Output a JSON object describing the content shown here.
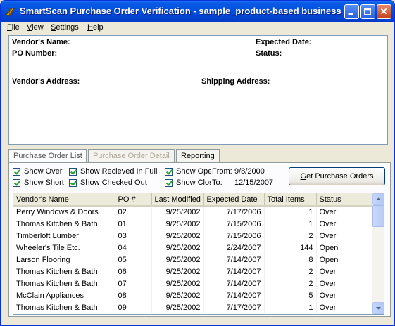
{
  "window": {
    "title": "SmartScan Purchase Order Verification - sample_product-based business"
  },
  "menu": [
    {
      "accel": "F",
      "rest": "ile"
    },
    {
      "accel": "V",
      "rest": "iew"
    },
    {
      "accel": "S",
      "rest": "ettings"
    },
    {
      "accel": "H",
      "rest": "elp"
    }
  ],
  "info": {
    "vendor_name_label": "Vendor's Name:",
    "po_number_label": "PO  Number:",
    "vendor_address_label": "Vendor's Address:",
    "expected_date_label": "Expected Date:",
    "status_label": "Status:",
    "shipping_address_label": "Shipping Address:"
  },
  "tabs": {
    "list": "Purchase Order List",
    "detail": "Purchase Order Detail",
    "reporting": "Reporting"
  },
  "filters": {
    "show_over": "Show Over",
    "show_short": "Show Short",
    "show_received_full": "Show Recieved In Full",
    "show_checked_out": "Show Checked Out",
    "show_open": "Show Open",
    "show_closed": "Show Closed",
    "from_label": "From:",
    "from_value": "9/8/2000",
    "to_label": "To:",
    "to_value": "12/15/2007"
  },
  "get_po_button": {
    "accel": "G",
    "rest": "et Purchase Orders"
  },
  "table": {
    "columns": [
      "Vendor's Name",
      "PO #",
      "Last Modified",
      "Expected Date",
      "Total Items",
      "Status"
    ],
    "rows": [
      [
        "Perry Windows & Doors",
        "02",
        "9/25/2002",
        "7/17/2006",
        "1",
        "Over"
      ],
      [
        "Thomas Kitchen & Bath",
        "01",
        "9/25/2002",
        "7/15/2006",
        "1",
        "Over"
      ],
      [
        "Timberloft Lumber",
        "03",
        "9/25/2002",
        "7/15/2006",
        "2",
        "Over"
      ],
      [
        "Wheeler's Tile Etc.",
        "04",
        "9/25/2002",
        "2/24/2007",
        "144",
        "Open"
      ],
      [
        "Larson Flooring",
        "05",
        "9/25/2002",
        "7/14/2007",
        "8",
        "Open"
      ],
      [
        "Thomas Kitchen & Bath",
        "06",
        "9/25/2002",
        "7/14/2007",
        "2",
        "Over"
      ],
      [
        "Thomas Kitchen & Bath",
        "07",
        "9/25/2002",
        "7/14/2007",
        "2",
        "Over"
      ],
      [
        "McClain Appliances",
        "08",
        "9/25/2002",
        "7/14/2007",
        "5",
        "Over"
      ],
      [
        "Thomas Kitchen & Bath",
        "09",
        "9/25/2002",
        "7/17/2007",
        "1",
        "Over"
      ]
    ]
  }
}
